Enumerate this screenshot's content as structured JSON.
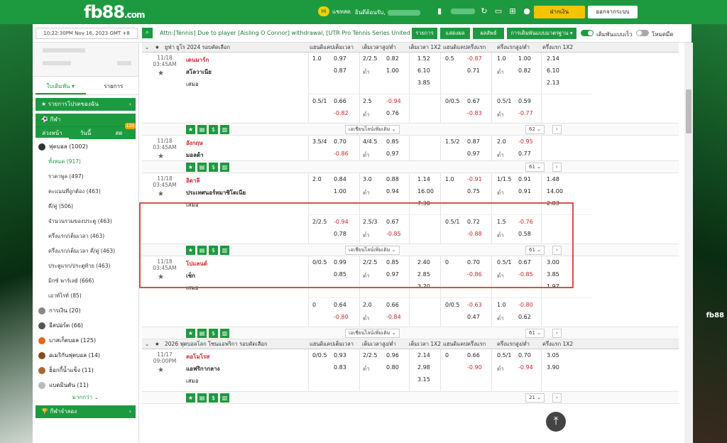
{
  "header": {
    "logo": "fb88",
    "logo_suffix": ".com",
    "chat": "แชทสด",
    "chat_badge": "Hi",
    "welcome": "ยินดีต้อนรับ,",
    "deposit": "ฝากเงิน",
    "logout": "ออกจากระบบ"
  },
  "newsbar": {
    "time": "10:22:30PM Nov 16, 2023 GMT +8",
    "marquee": "Attn:[Tennis] Due to player [Aisling O Connor] withdrawal, [UTR Pro Tennis Series United",
    "btn_list": "รายการ",
    "btn_result": "แสดงผล",
    "btn_result2": "ผลลัพธ์",
    "btn_bet": "การเดิมพันแบบมาตรฐาน",
    "toggle1": "เดิมพันแบบเร็ว",
    "toggle2": "โหมดมืด"
  },
  "sidebar": {
    "tab_bet": "ใบเดิมพัน",
    "tab_list": "รายการ",
    "favorites": "รายการโปรดของฉัน",
    "sports": "กีฬา",
    "tabs": [
      "ล่วงหน้า",
      "วันนี้",
      "สด"
    ],
    "live_badge": "129",
    "football": "ฟุตบอล (1002)",
    "subs": [
      "ทั้งหมด (917)",
      "ราคาพูล (497)",
      "คะแนนที่ถูกต้อง (463)",
      "คี่/คู่ (506)",
      "จำนวนรวมของประตู (463)",
      "ครึ่งแรก/เต็มเวลา (463)",
      "ครึ่งแรก/เต็มเวลา คี่/คู่ (463)",
      "ประตูแรก/ประตูท้าย (463)",
      "มิกซ์ พาร์เลย์ (666)",
      "เอาท์ไรท์ (85)"
    ],
    "others": [
      "การเงิน (20)",
      "อีสปอร์ต (66)",
      "บาสเก็ตบอล (125)",
      "อเมริกันฟุตบอล (14)",
      "ฮ็อกกี้น้ำแข็ง (11)",
      "แบดมินตัน (11)"
    ],
    "more": "มากกว่า",
    "virtual": "กีฬาจำลอง"
  },
  "table": {
    "headers": [
      "แฮนดิแคปเต็มเวลา",
      "เต็มเวลาสูง/ต่ำ",
      "เต็มเวลา 1X2",
      "แฮนดิแคปครึ่งแรก",
      "ครึ่งแรกสูง/ต่ำ",
      "ครึ่งแรก 1X2"
    ],
    "league1": "ยูฟ่า ยูโร 2024 รอบคัดเลือก",
    "league2": "2026 ฟุตบอลโลก โซนแอฟริกา รอบคัดเลือก",
    "more_lines": "เอเชียนไลน์เพิ่มเติม",
    "under": "ต่ำ"
  },
  "matches": [
    {
      "date": "11/18",
      "time": "03:45AM",
      "home": "เดนมาร์ก",
      "away": "สโลวาเนีย",
      "draw": "เสมอ",
      "more": "62",
      "r1": [
        "1.0",
        "0.97",
        "2/2.5",
        "0.82",
        "1.52",
        "0.5",
        "-0.87",
        "1.0",
        "1.00",
        "2.14"
      ],
      "r2": [
        "0.87",
        "1.00",
        "6.10",
        "0.71",
        "0.82",
        "6.10"
      ],
      "r3": [
        "3.85",
        "2.13"
      ],
      "r4": [
        "0.5/1",
        "0.66",
        "2.5",
        "-0.94",
        "0/0.5",
        "0.67",
        "0.5/1",
        "0.59"
      ],
      "r5": [
        "-0.82",
        "0.76",
        "-0.83",
        "-0.77"
      ]
    },
    {
      "date": "11/18",
      "time": "03:45AM",
      "home": "อังกฤษ",
      "away": "มอลต้า",
      "more": "61",
      "r1": [
        "3.5/4",
        "0.70",
        "4/4.5",
        "0.85",
        "1.5/2",
        "0.87",
        "2.0",
        "-0.95"
      ],
      "r2": [
        "-0.86",
        "0.97",
        "0.97",
        "0.77"
      ]
    },
    {
      "date": "11/18",
      "time": "03:45AM",
      "home": "อิตาลี",
      "away": "ประเทศนอร์ทมาซิโดเนีย",
      "draw": "เสมอ",
      "more": "61",
      "r1": [
        "2.0",
        "0.84",
        "3.0",
        "0.88",
        "1.14",
        "1.0",
        "-0.91",
        "1/1.5",
        "0.91",
        "1.48"
      ],
      "r2": [
        "1.00",
        "0.94",
        "16.00",
        "0.75",
        "0.91",
        "14.00"
      ],
      "r3": [
        "7.30",
        "2.83"
      ],
      "r4": [
        "2/2.5",
        "-0.94",
        "2.5/3",
        "0.67",
        "0.5/1",
        "0.72",
        "1.5",
        "-0.76"
      ],
      "r5": [
        "0.78",
        "-0.85",
        "-0.88",
        "0.58"
      ]
    },
    {
      "date": "11/18",
      "time": "03:45AM",
      "home": "โปแลนด์",
      "away": "เช็ก",
      "draw": "เสมอ",
      "more": "61",
      "r1": [
        "0/0.5",
        "0.99",
        "2/2.5",
        "0.85",
        "2.40",
        "0",
        "0.70",
        "0.5/1",
        "0.67",
        "3.00"
      ],
      "r2": [
        "0.85",
        "0.97",
        "2.85",
        "-0.86",
        "-0.85",
        "3.85"
      ],
      "r3": [
        "3.20",
        "1.97"
      ],
      "r4": [
        "0",
        "0.64",
        "2.0",
        "0.66",
        "0/0.5",
        "-0.63",
        "1.0",
        "-0.80"
      ],
      "r5": [
        "-0.80",
        "-0.84",
        "0.47",
        "0.62"
      ]
    },
    {
      "date": "11/17",
      "time": "09:00PM",
      "home": "คอโมโรส",
      "away": "แอฟริกากลาง",
      "draw": "เสมอ",
      "more": "21",
      "r1": [
        "0/0.5",
        "0.93",
        "2/2.5",
        "0.96",
        "2.14",
        "0",
        "0.66",
        "0.5/1",
        "0.70",
        "3.05"
      ],
      "r2": [
        "0.83",
        "0.80",
        "2.98",
        "-0.90",
        "-0.94",
        "3.90"
      ],
      "r3": [
        "3.15"
      ]
    }
  ]
}
